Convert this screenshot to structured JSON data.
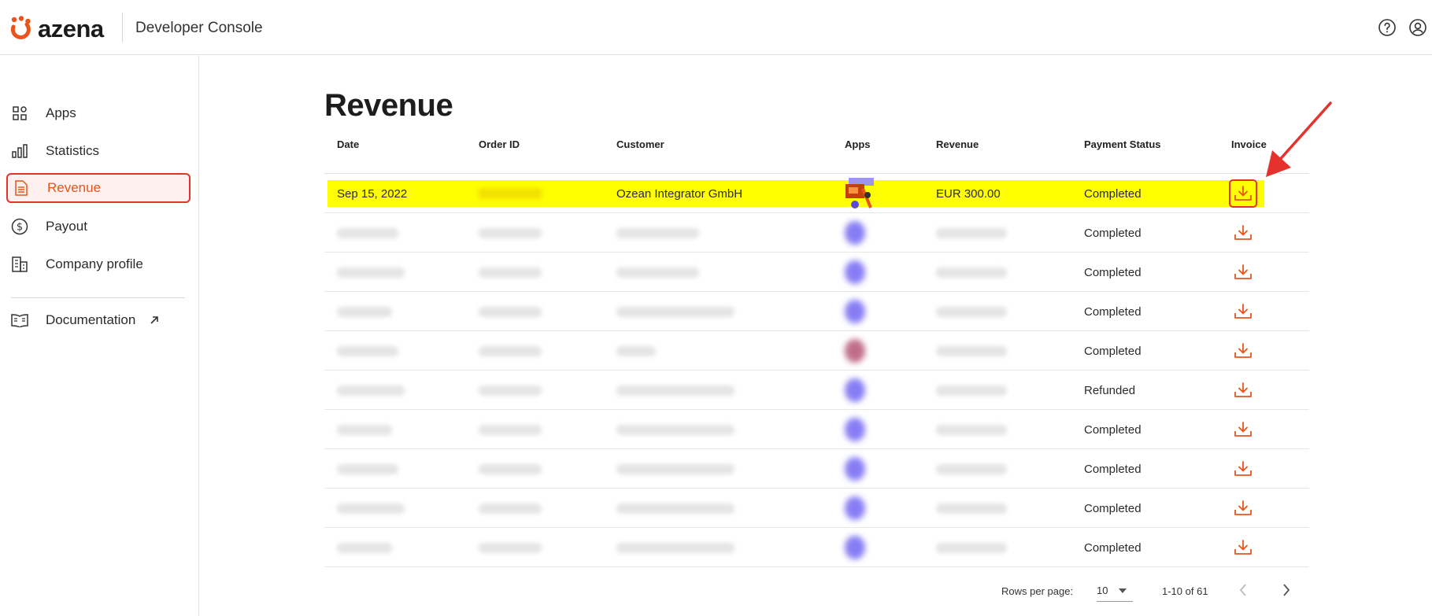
{
  "header": {
    "brand": "azena",
    "app_title": "Developer Console",
    "help_icon": "question-circle-icon",
    "user_icon": "user-circle-icon"
  },
  "sidebar": {
    "items": [
      {
        "label": "Apps",
        "icon": "grid-icon"
      },
      {
        "label": "Statistics",
        "icon": "bar-chart-icon"
      },
      {
        "label": "Revenue",
        "icon": "document-icon",
        "active": true
      },
      {
        "label": "Payout",
        "icon": "dollar-circle-icon"
      },
      {
        "label": "Company profile",
        "icon": "building-icon"
      }
    ],
    "docs": {
      "label": "Documentation",
      "icon": "book-icon",
      "external_icon": "arrow-up-right-icon"
    }
  },
  "main": {
    "title": "Revenue",
    "columns": [
      "Date",
      "Order ID",
      "Customer",
      "Apps",
      "Revenue",
      "Payment Status",
      "Invoice"
    ],
    "rows": [
      {
        "date": "Sep 15, 2022",
        "order_id": "",
        "customer": "Ozean Integrator GmbH",
        "revenue": "EUR 300.00",
        "status": "Completed",
        "highlight": true
      },
      {
        "date": "",
        "order_id": "",
        "customer": "",
        "revenue": "",
        "status": "Completed"
      },
      {
        "date": "",
        "order_id": "",
        "customer": "",
        "revenue": "",
        "status": "Completed"
      },
      {
        "date": "",
        "order_id": "",
        "customer": "",
        "revenue": "",
        "status": "Completed"
      },
      {
        "date": "",
        "order_id": "",
        "customer": "",
        "revenue": "",
        "status": "Completed"
      },
      {
        "date": "",
        "order_id": "",
        "customer": "",
        "revenue": "",
        "status": "Refunded"
      },
      {
        "date": "",
        "order_id": "",
        "customer": "",
        "revenue": "",
        "status": "Completed"
      },
      {
        "date": "",
        "order_id": "",
        "customer": "",
        "revenue": "",
        "status": "Completed"
      },
      {
        "date": "",
        "order_id": "",
        "customer": "",
        "revenue": "",
        "status": "Completed"
      },
      {
        "date": "",
        "order_id": "",
        "customer": "",
        "revenue": "",
        "status": "Completed"
      }
    ],
    "invoice_icon": "download-icon"
  },
  "pagination": {
    "rows_per_page_label": "Rows per page:",
    "rows_per_page_value": "10",
    "range": "1-10 of 61",
    "prev_icon": "chevron-left-icon",
    "next_icon": "chevron-right-icon"
  },
  "colors": {
    "accent": "#e8541c",
    "highlight": "#ffff00",
    "annotation": "#e5322d"
  }
}
